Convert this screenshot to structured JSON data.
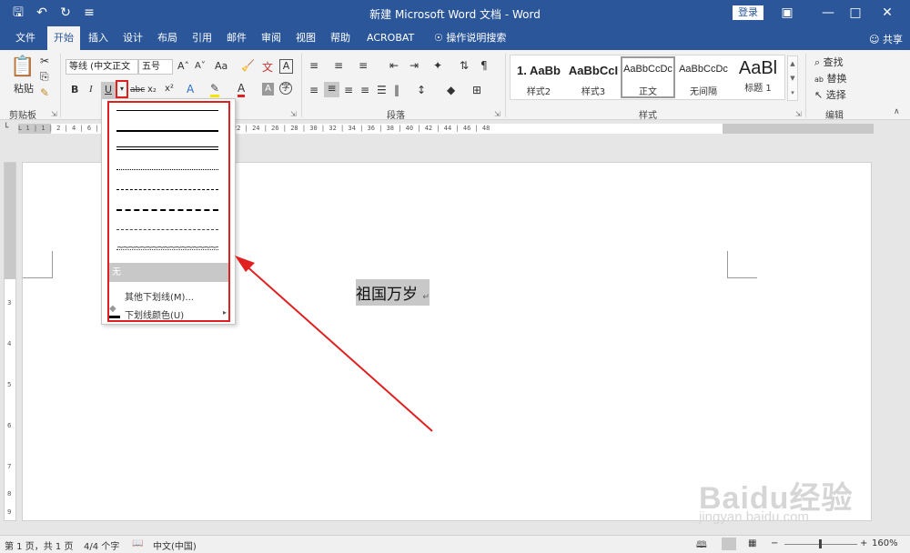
{
  "window": {
    "title": "新建 Microsoft Word 文档 - Word",
    "login_label": "登录",
    "share_label": "共享"
  },
  "tabs": [
    "文件",
    "开始",
    "插入",
    "设计",
    "布局",
    "引用",
    "邮件",
    "审阅",
    "视图",
    "帮助",
    "ACROBAT",
    "操作说明搜索"
  ],
  "active_tab": "开始",
  "ribbon": {
    "clipboard": {
      "paste_label": "粘贴",
      "group_label": "剪贴板"
    },
    "font": {
      "font_name": "等线 (中文正文",
      "font_size": "五号",
      "bold": "B",
      "italic": "I",
      "underline": "U",
      "strike": "abc",
      "subscript": "x₂",
      "superscript": "x²",
      "case_label": "Aa"
    },
    "paragraph": {
      "group_label": "段落"
    },
    "styles": {
      "group_label": "样式",
      "items": [
        {
          "sample": "1. AaBb",
          "name": "样式2"
        },
        {
          "sample": "AaBbCcI",
          "name": "样式3"
        },
        {
          "sample": "AaBbCcDc",
          "name": "正文"
        },
        {
          "sample": "AaBbCcDc",
          "name": "无间隔"
        },
        {
          "sample": "AaBl",
          "name": "标题 1"
        }
      ]
    },
    "editing": {
      "find": "查找",
      "replace": "替换",
      "select": "选择",
      "group_label": "编辑"
    }
  },
  "ruler_text": "L  1 | 1 | 2 | 4 | 6 | 8 | 10 | 12 | 14 | 16 | 18 | 20 | 22 | 24 | 26 | 28 | 30 | 32 | 34 | 36 | 38 | 40 | 42 | 44 | 46 | 48",
  "vruler_ticks": [
    "3",
    "4",
    "5",
    "6",
    "7",
    "8",
    "9"
  ],
  "document": {
    "text": "祖国万岁"
  },
  "underline_menu": {
    "none_label": "无",
    "more_label": "其他下划线(M)...",
    "color_label": "下划线颜色(U)"
  },
  "statusbar": {
    "page": "第 1 页，共 1 页",
    "words": "4/4 个字",
    "language": "中文(中国)",
    "zoom": "160%"
  },
  "watermark": {
    "main": "Baidu经验",
    "sub": "jingyan.baidu.com"
  },
  "colors": {
    "accent": "#2b579a",
    "highlight": "#e02020"
  }
}
